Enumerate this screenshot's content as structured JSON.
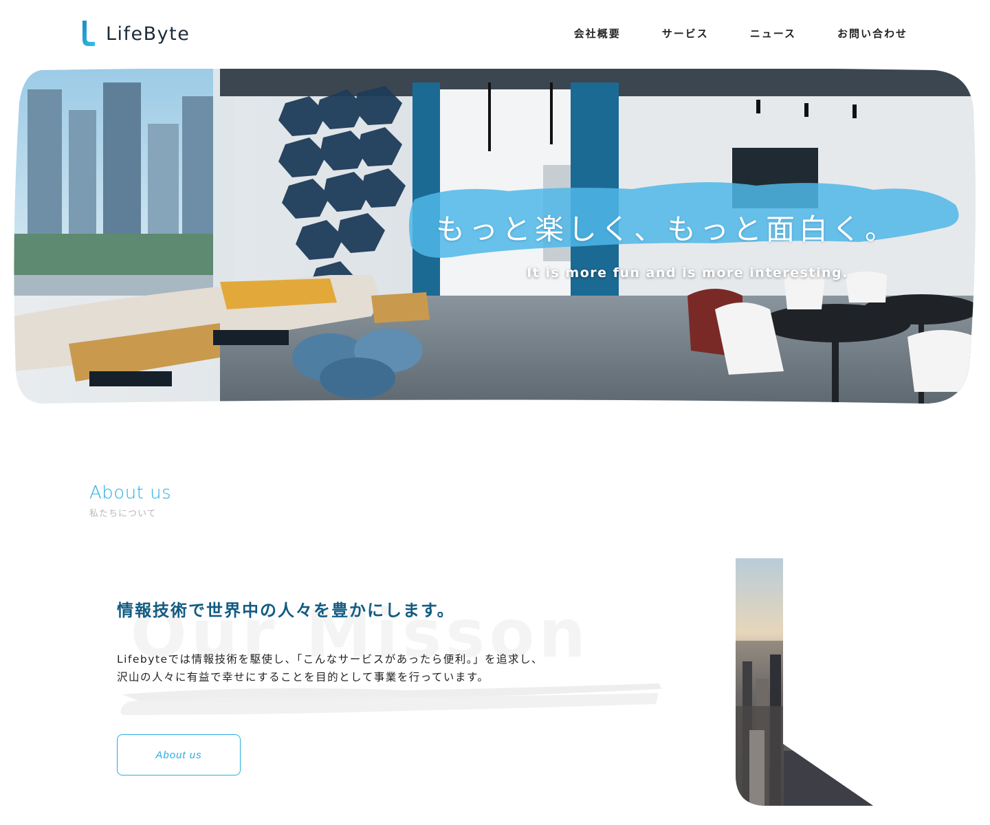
{
  "header": {
    "logo_text": "LifeByte",
    "logo_icon": "l-logo-icon",
    "nav": [
      {
        "label": "会社概要"
      },
      {
        "label": "サービス"
      },
      {
        "label": "ニュース"
      },
      {
        "label": "お問い合わせ"
      }
    ]
  },
  "hero": {
    "title": "もっと楽しく、もっと面白く。",
    "subtitle": "It is more fun  and  is more interesting."
  },
  "about": {
    "heading_en": "About us",
    "heading_jp": "私たちについて"
  },
  "mission": {
    "watermark": "Our Misson",
    "title": "情報技術で世界中の人々を豊かにします。",
    "line1": "Lifebyteでは情報技術を駆使し、「こんなサービスがあったら便利。」を追求し、",
    "line2": "沢山の人々に有益で幸せにすることを目的として事業を行っています。",
    "button_label": "About us"
  },
  "colors": {
    "accent": "#29aee0",
    "title_blue": "#125b82",
    "text": "#222222",
    "muted": "#b8b8b8"
  }
}
